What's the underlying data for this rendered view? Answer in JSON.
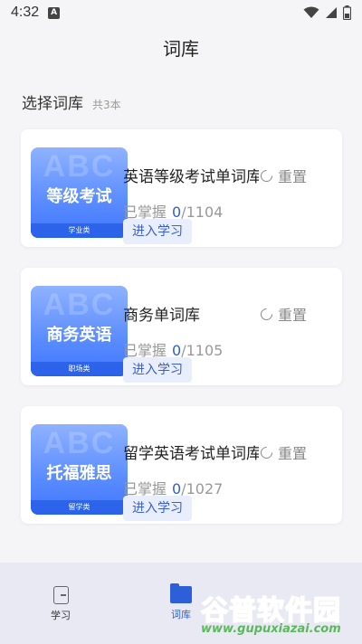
{
  "status_bar": {
    "time": "4:32",
    "app_icon_letter": "A"
  },
  "page": {
    "title": "词库"
  },
  "section": {
    "title": "选择词库",
    "count": "共3本"
  },
  "books": [
    {
      "cover_title": "等级考试",
      "cover_watermark": "ABC",
      "cover_tag": "学业类",
      "name": "英语等级考试单词库",
      "reset_label": "重置",
      "progress_label": "已掌握",
      "mastered": "0",
      "total": "/1104",
      "study_label": "进入学习"
    },
    {
      "cover_title": "商务英语",
      "cover_watermark": "ABC",
      "cover_tag": "职场类",
      "name": "商务单词库",
      "reset_label": "重置",
      "progress_label": "已掌握",
      "mastered": "0",
      "total": "/1105",
      "study_label": "进入学习"
    },
    {
      "cover_title": "托福雅思",
      "cover_watermark": "ABC",
      "cover_tag": "留学类",
      "name": "留学英语考试单词库",
      "reset_label": "重置",
      "progress_label": "已掌握",
      "mastered": "0",
      "total": "/1027",
      "study_label": "进入学习"
    }
  ],
  "tabs": [
    {
      "label": "学习",
      "icon": "document-icon",
      "active": false
    },
    {
      "label": "词库",
      "icon": "folder-icon",
      "active": true
    }
  ],
  "watermark": {
    "main": "谷普软件园",
    "url": "www.gupuxiazai.com"
  },
  "colors": {
    "accent": "#2d5fd8",
    "cover_gradient_start": "#8fb2ff",
    "cover_gradient_end": "#3e75ff",
    "tab_bar_bg": "#e9e9f4"
  }
}
